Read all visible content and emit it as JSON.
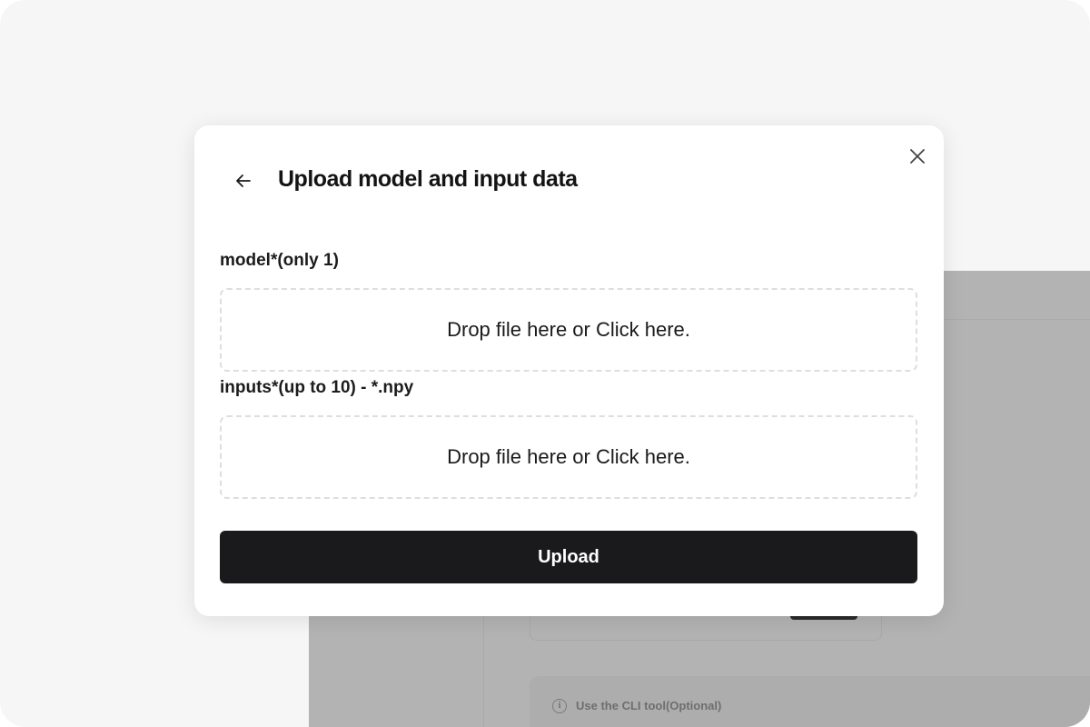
{
  "modal": {
    "title": "Upload model and input data",
    "model_label": "model*(only 1)",
    "model_dropzone_text": "Drop file here or Click here.",
    "inputs_label": "inputs*(up to 10) - *.npy",
    "inputs_dropzone_text": "Drop file here or Click here.",
    "upload_label": "Upload"
  },
  "background": {
    "info_text": "Use the CLI tool(Optional)",
    "info_icon": "info-icon"
  },
  "icons": {
    "back": "arrow-left-icon",
    "close": "close-icon"
  },
  "colors": {
    "primary_button": "#1a1a1c",
    "dropzone_border": "#dedede",
    "overlay_background": "#b3b3b3"
  }
}
